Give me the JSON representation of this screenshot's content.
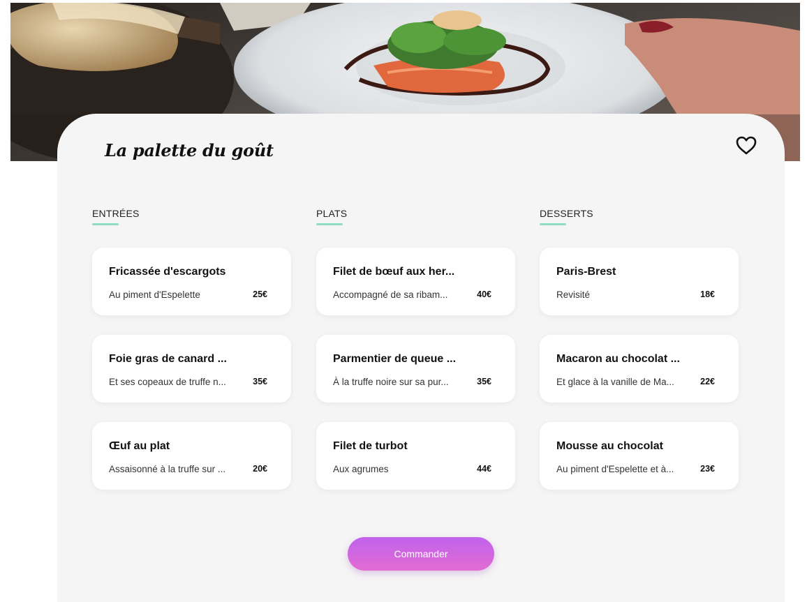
{
  "restaurant": {
    "name": "La palette du goût"
  },
  "icons": {
    "favorite": "heart-outline-icon"
  },
  "colors": {
    "accent_underline": "#8fdcc6",
    "button_gradient_top": "#c063ec",
    "button_gradient_bottom": "#e26bd3",
    "card_background": "#f5f5f5"
  },
  "menu": {
    "columns": [
      {
        "heading": "ENTRÉES",
        "items": [
          {
            "name": "Fricassée d'escargots",
            "desc": "Au piment d'Espelette",
            "price": "25€"
          },
          {
            "name": "Foie gras de canard ...",
            "desc": "Et ses copeaux de truffe n...",
            "price": "35€"
          },
          {
            "name": "Œuf au plat",
            "desc": "Assaisonné à la truffe sur ...",
            "price": "20€"
          }
        ]
      },
      {
        "heading": "PLATS",
        "items": [
          {
            "name": "Filet de bœuf aux her...",
            "desc": "Accompagné de sa ribam...",
            "price": "40€"
          },
          {
            "name": "Parmentier de queue ...",
            "desc": "À la truffe noire sur sa pur...",
            "price": "35€"
          },
          {
            "name": "Filet de turbot",
            "desc": "Aux agrumes",
            "price": "44€"
          }
        ]
      },
      {
        "heading": "DESSERTS",
        "items": [
          {
            "name": "Paris-Brest",
            "desc": "Revisité",
            "price": "18€"
          },
          {
            "name": "Macaron au chocolat ...",
            "desc": "Et glace à la vanille de Ma...",
            "price": "22€"
          },
          {
            "name": "Mousse au chocolat",
            "desc": "Au piment d'Espelette et à...",
            "price": "23€"
          }
        ]
      }
    ]
  },
  "actions": {
    "order_label": "Commander"
  }
}
